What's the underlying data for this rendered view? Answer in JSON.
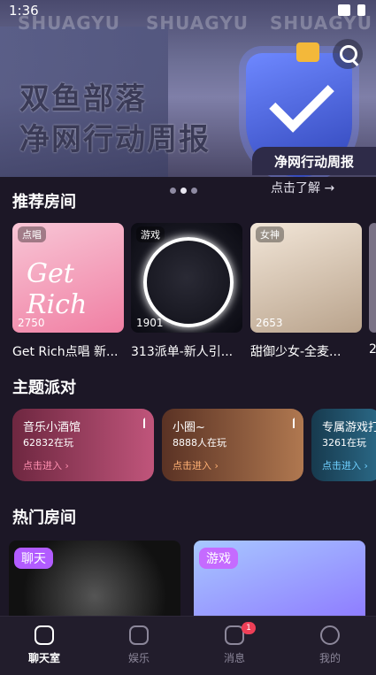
{
  "status_bar": {
    "time": "1:36"
  },
  "banner": {
    "watermark": "SHUAGYU",
    "title_line1": "双鱼部落",
    "title_line2": "净网行动周报",
    "tag": "净网行动周报",
    "link": "点击了解 →"
  },
  "recommended": {
    "heading": "推荐房间",
    "rooms": [
      {
        "tag": "点唱",
        "count": "2750",
        "title": "Get Rich点唱 新..."
      },
      {
        "tag": "游戏",
        "count": "1901",
        "title": "313派单-新人引..."
      },
      {
        "tag": "女神",
        "count": "2653",
        "title": "甜御少女-全麦..."
      },
      {
        "tag": "",
        "count": "",
        "title": "2"
      }
    ]
  },
  "themes": {
    "heading": "主题派对",
    "items": [
      {
        "name": "音乐小酒馆",
        "popularity": "62832在玩",
        "enter": "点击进入 ›"
      },
      {
        "name": "小圈~",
        "popularity": "8888人在玩",
        "enter": "点击进入 ›"
      },
      {
        "name": "专属游戏打",
        "popularity": "3261在玩",
        "enter": "点击进入 ›"
      }
    ]
  },
  "hot": {
    "heading": "热门房间",
    "rooms": [
      {
        "badge": "聊天"
      },
      {
        "badge": "游戏"
      }
    ]
  },
  "tabbar": {
    "items": [
      {
        "label": "聊天室",
        "active": true
      },
      {
        "label": "娱乐"
      },
      {
        "label": "消息",
        "badge": "1"
      },
      {
        "label": "我的"
      }
    ]
  },
  "colors": {
    "background": "#1c1726",
    "theme1": "#8a2f4e",
    "theme2": "#6a3a2a",
    "theme3": "#1f4e66",
    "enter_pink": "#ff6b98",
    "enter_orange": "#ff9d4d",
    "enter_blue": "#5fc3ff"
  }
}
